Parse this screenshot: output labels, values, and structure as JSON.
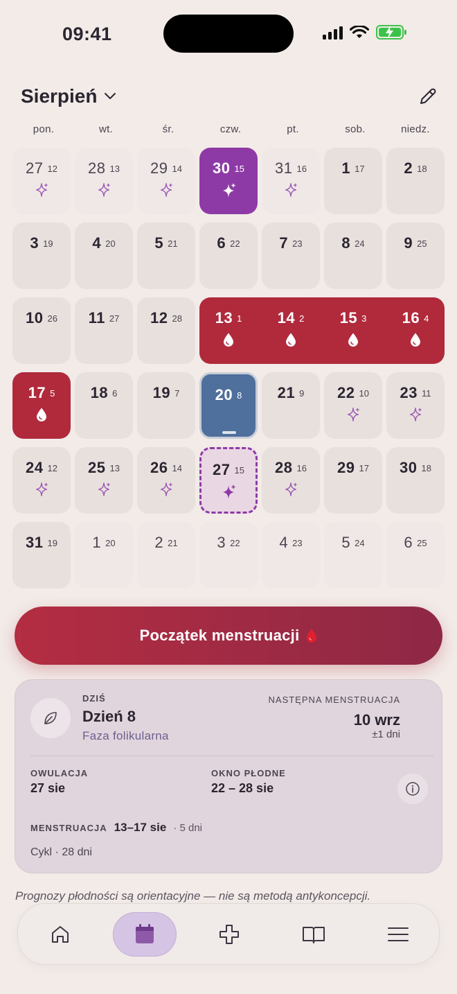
{
  "status_bar": {
    "time": "09:41"
  },
  "header": {
    "month": "Sierpień"
  },
  "weekdays": [
    "pon.",
    "wt.",
    "śr.",
    "czw.",
    "pt.",
    "sob.",
    "niedz."
  ],
  "calendar": {
    "days": [
      {
        "day": "27",
        "cycle_day": "12",
        "type": "other",
        "icon": "sparkle-icon"
      },
      {
        "day": "28",
        "cycle_day": "13",
        "type": "other",
        "icon": "sparkle-icon"
      },
      {
        "day": "29",
        "cycle_day": "14",
        "type": "other",
        "icon": "sparkle-icon"
      },
      {
        "day": "30",
        "cycle_day": "15",
        "type": "fertile-max",
        "icon": "sparkle-icon"
      },
      {
        "day": "31",
        "cycle_day": "16",
        "type": "other",
        "icon": "sparkle-icon"
      },
      {
        "day": "1",
        "cycle_day": "17",
        "type": "normal"
      },
      {
        "day": "2",
        "cycle_day": "18",
        "type": "normal"
      },
      {
        "day": "3",
        "cycle_day": "19",
        "type": "normal"
      },
      {
        "day": "4",
        "cycle_day": "20",
        "type": "normal"
      },
      {
        "day": "5",
        "cycle_day": "21",
        "type": "normal"
      },
      {
        "day": "6",
        "cycle_day": "22",
        "type": "normal"
      },
      {
        "day": "7",
        "cycle_day": "23",
        "type": "normal"
      },
      {
        "day": "8",
        "cycle_day": "24",
        "type": "normal"
      },
      {
        "day": "9",
        "cycle_day": "25",
        "type": "normal"
      },
      {
        "day": "10",
        "cycle_day": "26",
        "type": "normal"
      },
      {
        "day": "11",
        "cycle_day": "27",
        "type": "normal"
      },
      {
        "day": "12",
        "cycle_day": "28",
        "type": "normal"
      },
      {
        "day": "13",
        "cycle_day": "1",
        "type": "period",
        "icon": "drop-icon"
      },
      {
        "day": "14",
        "cycle_day": "2",
        "type": "period",
        "icon": "drop-icon"
      },
      {
        "day": "15",
        "cycle_day": "3",
        "type": "period",
        "icon": "drop-icon"
      },
      {
        "day": "16",
        "cycle_day": "4",
        "type": "period",
        "icon": "drop-icon"
      },
      {
        "day": "17",
        "cycle_day": "5",
        "type": "period solo",
        "icon": "drop-icon"
      },
      {
        "day": "18",
        "cycle_day": "6",
        "type": "normal"
      },
      {
        "day": "19",
        "cycle_day": "7",
        "type": "normal"
      },
      {
        "day": "20",
        "cycle_day": "8",
        "type": "today"
      },
      {
        "day": "21",
        "cycle_day": "9",
        "type": "normal"
      },
      {
        "day": "22",
        "cycle_day": "10",
        "type": "normal",
        "icon": "sparkle-icon"
      },
      {
        "day": "23",
        "cycle_day": "11",
        "type": "normal",
        "icon": "sparkle-icon"
      },
      {
        "day": "24",
        "cycle_day": "12",
        "type": "normal",
        "icon": "sparkle-icon"
      },
      {
        "day": "25",
        "cycle_day": "13",
        "type": "normal",
        "icon": "sparkle-icon"
      },
      {
        "day": "26",
        "cycle_day": "14",
        "type": "normal",
        "icon": "sparkle-icon"
      },
      {
        "day": "27",
        "cycle_day": "15",
        "type": "ovulation",
        "icon": "sparkle-icon"
      },
      {
        "day": "28",
        "cycle_day": "16",
        "type": "normal",
        "icon": "sparkle-icon"
      },
      {
        "day": "29",
        "cycle_day": "17",
        "type": "normal"
      },
      {
        "day": "30",
        "cycle_day": "18",
        "type": "normal"
      },
      {
        "day": "31",
        "cycle_day": "19",
        "type": "normal"
      },
      {
        "day": "1",
        "cycle_day": "20",
        "type": "other"
      },
      {
        "day": "2",
        "cycle_day": "21",
        "type": "other"
      },
      {
        "day": "3",
        "cycle_day": "22",
        "type": "other"
      },
      {
        "day": "4",
        "cycle_day": "23",
        "type": "other"
      },
      {
        "day": "5",
        "cycle_day": "24",
        "type": "other"
      },
      {
        "day": "6",
        "cycle_day": "25",
        "type": "other"
      }
    ]
  },
  "start_button": {
    "label": "Początek menstruacji"
  },
  "summary": {
    "today_label": "DZIŚ",
    "today_day": "Dzień 8",
    "phase": "Faza folikularna",
    "next_label": "NASTĘPNA MENSTRUACJA",
    "next_date": "10 wrz",
    "next_range": "±1 dni",
    "ovulation_label": "OWULACJA",
    "ovulation_value": "27 sie",
    "fertile_label": "OKNO PŁODNE",
    "fertile_value": "22 – 28 sie",
    "menstruation_label": "MENSTRUACJA",
    "menstruation_value": "13–17 sie",
    "menstruation_length": "· 5 dni",
    "cycle": "Cykl · 28 dni"
  },
  "disclaimer": "Prognozy płodności są orientacyjne — nie są metodą antykoncepcji.",
  "tabbar": {
    "tabs": [
      {
        "name": "home-icon",
        "active": false
      },
      {
        "name": "calendar-icon",
        "active": true
      },
      {
        "name": "plus-icon",
        "active": false
      },
      {
        "name": "book-icon",
        "active": false
      },
      {
        "name": "menu-icon",
        "active": false
      }
    ]
  },
  "colors": {
    "background": "#f2ebe8",
    "period": "#b02a3c",
    "fertile": "#8e3aa6",
    "today": "#4f6f9c",
    "phase_text": "#6a5f8e"
  }
}
